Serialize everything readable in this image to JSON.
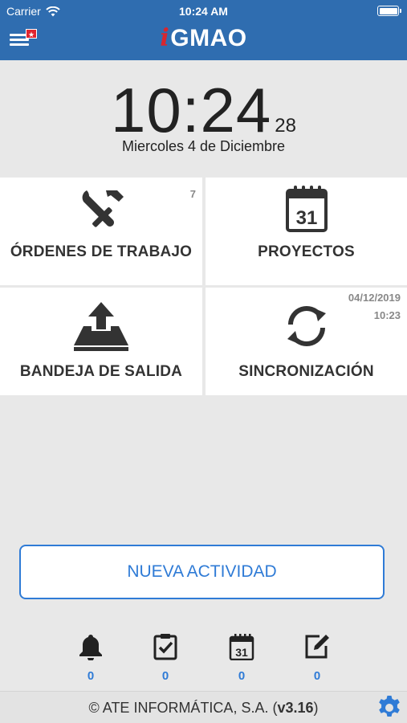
{
  "status_bar": {
    "carrier": "Carrier",
    "time": "10:24 AM"
  },
  "header": {
    "logo_prefix": "i",
    "logo_text": "GMAO",
    "menu_flag": "★"
  },
  "clock": {
    "hours_minutes": "10:24",
    "seconds": "28",
    "date": "Miercoles 4 de Diciembre"
  },
  "tiles": {
    "ordenes": {
      "label": "ÓRDENES DE TRABAJO",
      "badge": "7",
      "icon": "tools-icon"
    },
    "proyectos": {
      "label": "PROYECTOS",
      "icon": "calendar-icon",
      "calendar_day": "31"
    },
    "bandeja": {
      "label": "BANDEJA DE SALIDA",
      "icon": "outbox-upload-icon"
    },
    "sincronizacion": {
      "label": "SINCRONIZACIÓN",
      "date": "04/12/2019",
      "time": "10:23",
      "icon": "sync-icon"
    }
  },
  "new_activity": {
    "label": "NUEVA ACTIVIDAD"
  },
  "counters": [
    {
      "icon": "bell-icon",
      "count": "0"
    },
    {
      "icon": "checklist-icon",
      "count": "0"
    },
    {
      "icon": "calendar-icon",
      "count": "0",
      "calendar_day": "31"
    },
    {
      "icon": "edit-note-icon",
      "count": "0"
    }
  ],
  "footer": {
    "copyright_prefix": "© ATE INFORMÁTICA, S.A. (",
    "version": "v3.16",
    "copyright_suffix": ")"
  },
  "colors": {
    "header_blue": "#2f6db0",
    "accent_blue": "#2f7bd6",
    "logo_red": "#d7262e",
    "background": "#e8e8e8"
  }
}
